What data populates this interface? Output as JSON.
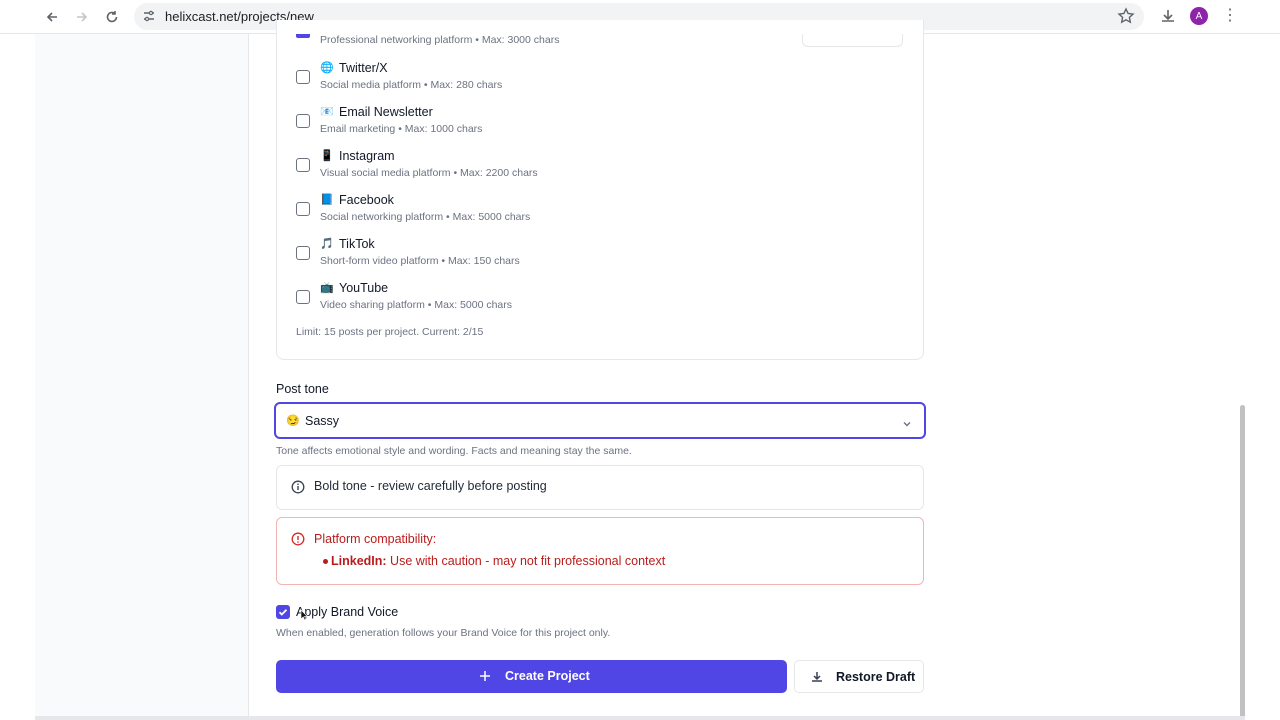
{
  "browser": {
    "url": "helixcast.net/projects/new",
    "avatar_letter": "A"
  },
  "platforms": {
    "partial_top_desc": "Professional networking platform • Max: 3000 chars",
    "items": [
      {
        "icon": "🌐",
        "name": "Twitter/X",
        "desc": "Social media platform • Max: 280 chars"
      },
      {
        "icon": "📧",
        "name": "Email Newsletter",
        "desc": "Email marketing • Max: 1000 chars"
      },
      {
        "icon": "📱",
        "name": "Instagram",
        "desc": "Visual social media platform • Max: 2200 chars"
      },
      {
        "icon": "📘",
        "name": "Facebook",
        "desc": "Social networking platform • Max: 5000 chars"
      },
      {
        "icon": "🎵",
        "name": "TikTok",
        "desc": "Short-form video platform • Max: 150 chars"
      },
      {
        "icon": "📺",
        "name": "YouTube",
        "desc": "Video sharing platform • Max: 5000 chars"
      }
    ],
    "limit_text": "Limit: 15 posts per project. Current: 2/15"
  },
  "tone": {
    "label": "Post tone",
    "emoji": "😏",
    "value": "Sassy",
    "help": "Tone affects emotional style and wording. Facts and meaning stay the same."
  },
  "info": {
    "text": "Bold tone - review carefully before posting"
  },
  "warning": {
    "title": "Platform compatibility:",
    "platform": "LinkedIn:",
    "message": "Use with caution - may not fit professional context"
  },
  "brand_voice": {
    "label": "Apply Brand Voice",
    "checked": true,
    "help": "When enabled, generation follows your Brand Voice for this project only."
  },
  "actions": {
    "create_label": "Create Project",
    "restore_label": "Restore Draft"
  },
  "colors": {
    "accent": "#4f46e5",
    "warning": "#b91c1c"
  }
}
